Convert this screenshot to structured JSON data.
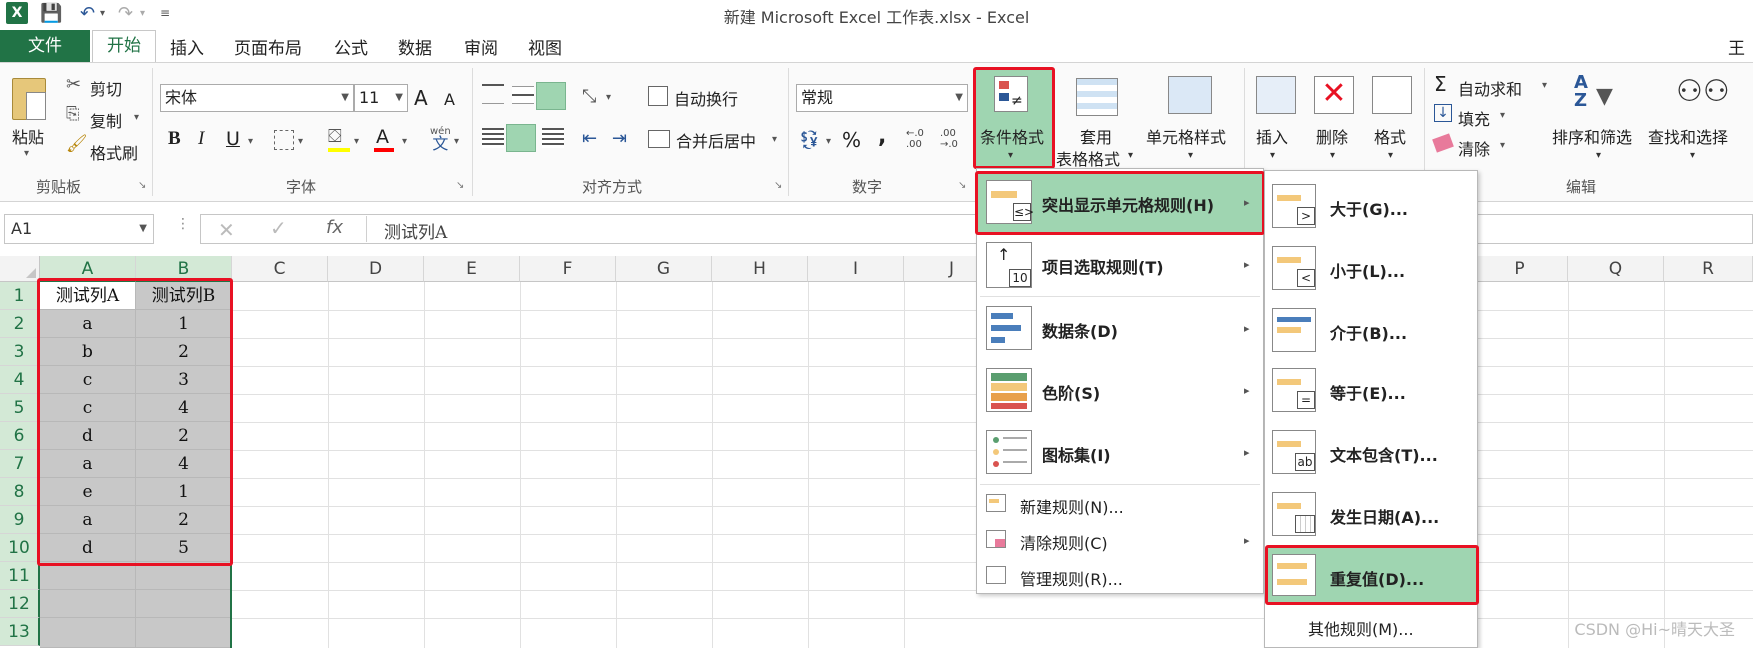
{
  "window": {
    "title": "新建 Microsoft Excel 工作表.xlsx - Excel",
    "app_badge": "X",
    "user_initial": "王"
  },
  "menu": {
    "file": "文件",
    "tabs": [
      "开始",
      "插入",
      "页面布局",
      "公式",
      "数据",
      "审阅",
      "视图"
    ]
  },
  "ribbon": {
    "clipboard": {
      "paste": "粘贴",
      "cut": "剪切",
      "copy": "复制",
      "format_painter": "格式刷",
      "label": "剪贴板"
    },
    "font": {
      "name": "宋体",
      "size": "11",
      "grow": "A",
      "shrink": "A",
      "bold": "B",
      "italic": "I",
      "underline": "U",
      "font_color": "A",
      "phonetic": "wén",
      "phonetic_char": "文",
      "label": "字体"
    },
    "alignment": {
      "wrap": "自动换行",
      "merge": "合并后居中",
      "label": "对齐方式"
    },
    "number": {
      "format": "常规",
      "percent": "%",
      "comma": ",",
      "inc_decimal_top": "←.0",
      "inc_decimal_bottom": ".00",
      "dec_decimal_top": ".00",
      "dec_decimal_bottom": "→.0",
      "label": "数字"
    },
    "styles": {
      "conditional_format": "条件格式",
      "format_table_1": "套用",
      "format_table_2": "表格格式",
      "cell_styles": "单元格样式"
    },
    "cells": {
      "insert": "插入",
      "delete": "删除",
      "format": "格式"
    },
    "editing": {
      "sigma": "Σ",
      "autosum": "自动求和",
      "fill": "填充",
      "clear": "清除",
      "sort_filter": "排序和筛选",
      "find_select": "查找和选择",
      "label": "编辑"
    }
  },
  "formula_bar": {
    "name_box": "A1",
    "fx": "fx",
    "content": "测试列A"
  },
  "columns": [
    "A",
    "B",
    "C",
    "D",
    "E",
    "F",
    "G",
    "H",
    "I",
    "J",
    "P",
    "Q",
    "R"
  ],
  "rows": [
    "1",
    "2",
    "3",
    "4",
    "5",
    "6",
    "7",
    "8",
    "9",
    "10",
    "11",
    "12",
    "13"
  ],
  "sheet": {
    "header": [
      "测试列A",
      "测试列B"
    ],
    "rows": [
      [
        "a",
        "1"
      ],
      [
        "b",
        "2"
      ],
      [
        "c",
        "3"
      ],
      [
        "c",
        "4"
      ],
      [
        "d",
        "2"
      ],
      [
        "a",
        "4"
      ],
      [
        "e",
        "1"
      ],
      [
        "a",
        "2"
      ],
      [
        "d",
        "5"
      ]
    ]
  },
  "cf_menu": {
    "items": [
      "突出显示单元格规则(H)",
      "项目选取规则(T)",
      "数据条(D)",
      "色阶(S)",
      "图标集(I)"
    ],
    "top10_label": "10",
    "bottom_items": [
      "新建规则(N)...",
      "清除规则(C)",
      "管理规则(R)..."
    ]
  },
  "highlight_menu": {
    "items": [
      "大于(G)...",
      "小于(L)...",
      "介于(B)...",
      "等于(E)...",
      "文本包含(T)...",
      "发生日期(A)...",
      "重复值(D)..."
    ],
    "icon_glyphs": [
      ">",
      "<",
      "",
      "=",
      "ab",
      "",
      ""
    ],
    "more": "其他规则(M)..."
  },
  "watermark": "CSDN @Hi~晴天大圣"
}
